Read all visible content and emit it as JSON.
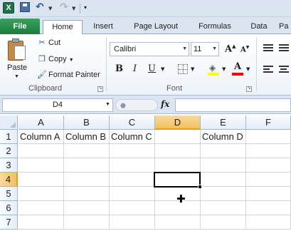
{
  "app": {
    "logo_text": "X"
  },
  "tabs": [
    {
      "label": "File"
    },
    {
      "label": "Home"
    },
    {
      "label": "Insert"
    },
    {
      "label": "Page Layout"
    },
    {
      "label": "Formulas"
    },
    {
      "label": "Data"
    },
    {
      "label": "Pa"
    }
  ],
  "clipboard": {
    "paste_label": "Paste",
    "cut_label": "Cut",
    "copy_label": "Copy",
    "format_painter_label": "Format Painter",
    "group_label": "Clipboard"
  },
  "font": {
    "name": "Calibri",
    "size": "11",
    "bold": "B",
    "italic": "I",
    "underline": "U",
    "grow": "A",
    "shrink": "A",
    "color_letter": "A",
    "group_label": "Font",
    "fill_color": "#ffff00",
    "font_color": "#ff0000"
  },
  "formula_bar": {
    "name_box": "D4",
    "fx": "fx",
    "value": ""
  },
  "sheet": {
    "columns": [
      "A",
      "B",
      "C",
      "D",
      "E",
      "F"
    ],
    "rows": [
      "1",
      "2",
      "3",
      "4",
      "5",
      "6",
      "7"
    ],
    "selected_column": "D",
    "selected_row": "4",
    "cells": {
      "A1": "Column A",
      "B1": "Column B",
      "C1": "Column C",
      "D1": "",
      "E1": "Column D"
    }
  },
  "icons": [
    "excel-logo-icon",
    "save-icon",
    "undo-icon",
    "redo-icon",
    "paste-icon",
    "cut-icon",
    "copy-icon",
    "format-painter-icon",
    "grow-font-icon",
    "shrink-font-icon",
    "borders-icon",
    "fill-color-icon",
    "font-color-icon",
    "fx-icon",
    "cell-cursor-icon"
  ]
}
